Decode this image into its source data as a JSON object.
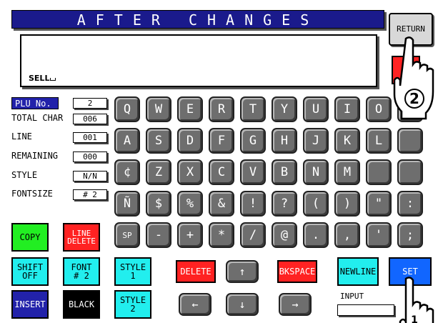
{
  "header": {
    "title": "AFTER CHANGES"
  },
  "display": {
    "text": "SELL"
  },
  "return_label": "RETURN",
  "hand_labels": {
    "top": "2",
    "bottom": "1"
  },
  "info": {
    "plu_label": "PLU No.",
    "plu_value": "2",
    "total_char_label": "TOTAL CHAR",
    "total_char_value": "006",
    "line_label": "LINE",
    "line_value": "001",
    "remaining_label": "REMAINING",
    "remaining_value": "000",
    "style_label": "STYLE",
    "style_value": "N/N",
    "fontsize_label": "FONTSIZE",
    "fontsize_value": "# 2"
  },
  "keys": {
    "row1": [
      "Q",
      "W",
      "E",
      "R",
      "T",
      "Y",
      "U",
      "I",
      "O",
      ""
    ],
    "row2": [
      "A",
      "S",
      "D",
      "F",
      "G",
      "H",
      "J",
      "K",
      "L",
      ""
    ],
    "row3": [
      "¢",
      "Z",
      "X",
      "C",
      "V",
      "B",
      "N",
      "M",
      "",
      ""
    ],
    "row4": [
      "Ñ",
      "$",
      "%",
      "&",
      "!",
      "?",
      "(",
      ")",
      "\"",
      ":"
    ],
    "row5": [
      "SP",
      "-",
      "+",
      "*",
      "/",
      "@",
      ".",
      ",",
      "'",
      ";"
    ]
  },
  "buttons": {
    "copy": "COPY",
    "line_delete_1": "LINE",
    "line_delete_2": "DELETE",
    "shift_1": "SHIFT",
    "shift_2": "OFF",
    "font_1": "FONT",
    "font_2": "# 2",
    "style1": "STYLE 1",
    "style2": "STYLE 2",
    "delete": "DELETE",
    "bkspace": "BKSPACE",
    "newline": "NEWLINE",
    "set": "SET",
    "insert": "INSERT",
    "black": "BLACK",
    "up": "↑",
    "down": "↓",
    "left": "←",
    "right": "→",
    "input_label": "INPUT"
  },
  "colors": {
    "title_bg": "#1a1a8c",
    "red": "#ff2222",
    "green": "#22ee22",
    "cyan": "#22eeee",
    "blue": "#1166ff"
  }
}
